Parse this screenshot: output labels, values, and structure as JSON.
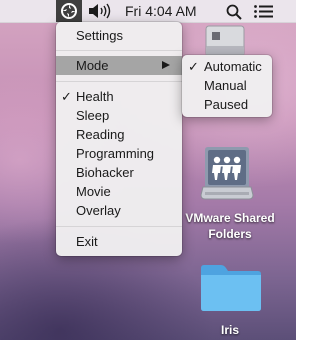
{
  "menubar": {
    "clock": "Fri 4:04 AM",
    "icons": [
      "app-status-icon",
      "volume-icon",
      "spotlight-icon",
      "list-icon"
    ]
  },
  "main_menu": {
    "settings": "Settings",
    "mode": "Mode",
    "profiles": [
      {
        "label": "Health",
        "checked": true
      },
      {
        "label": "Sleep",
        "checked": false
      },
      {
        "label": "Reading",
        "checked": false
      },
      {
        "label": "Programming",
        "checked": false
      },
      {
        "label": "Biohacker",
        "checked": false
      },
      {
        "label": "Movie",
        "checked": false
      },
      {
        "label": "Overlay",
        "checked": false
      }
    ],
    "exit": "Exit",
    "check_glyph": "✓"
  },
  "mode_submenu": {
    "options": [
      {
        "label": "Automatic",
        "checked": true
      },
      {
        "label": "Manual",
        "checked": false
      },
      {
        "label": "Paused",
        "checked": false
      }
    ]
  },
  "desktop": {
    "items": [
      {
        "label": "VMware Shared Folders",
        "icon": "network-drive-icon"
      },
      {
        "label": "Iris",
        "icon": "folder-icon"
      }
    ]
  },
  "colors": {
    "menu_highlight": "#a5a5a5",
    "folder": "#5fb4ec"
  }
}
